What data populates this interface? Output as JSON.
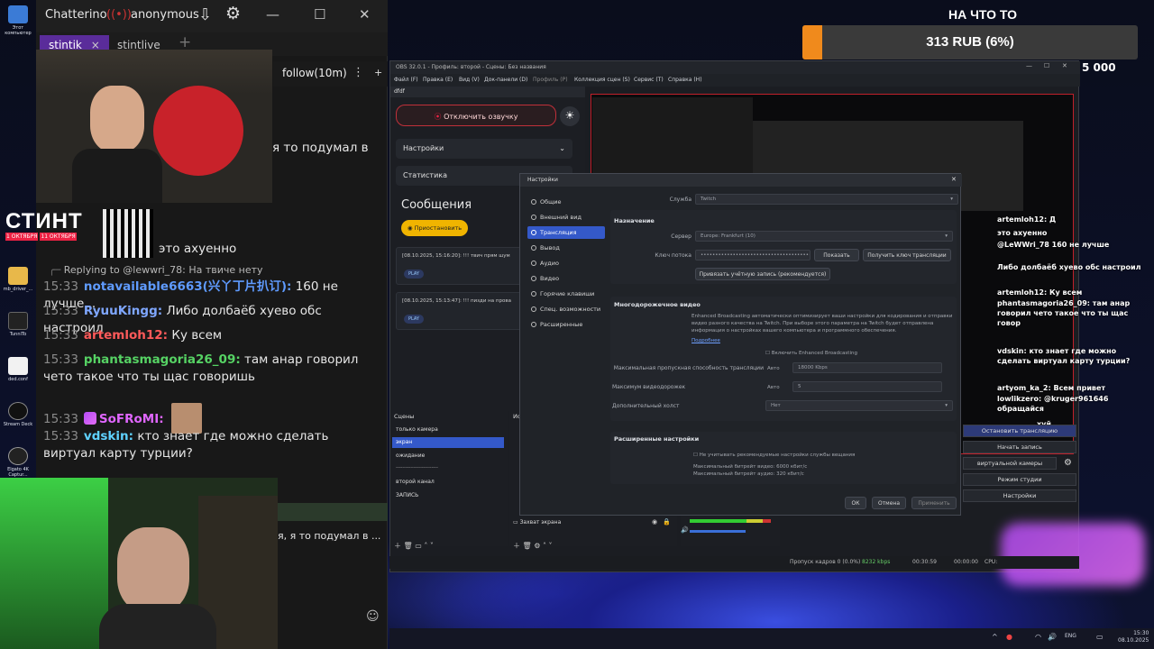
{
  "desktop_icons": [
    {
      "label": "Этот компьютер"
    },
    {
      "label": "mb_driver_..."
    },
    {
      "label": "TunnITo"
    },
    {
      "label": "ded.conf"
    },
    {
      "label": "Stream Deck"
    },
    {
      "label": "Elgato 4K Captur..."
    }
  ],
  "chatterino": {
    "title": "Chatterino",
    "user": "anonymous",
    "tabs": [
      "stintik",
      "stintlive"
    ],
    "channel_status": "follow(10m)",
    "partial_text_1": "я то подумал в",
    "partial_text_2": "это ахуенно",
    "reply": {
      "prefix": "Replying to",
      "target": "@lewwri_78:",
      "text": "На твиче нету"
    },
    "messages": [
      {
        "time": "15:33",
        "user": "notavailable6663(兴丫丁片扒订):",
        "text": "160 не лучше...",
        "color": "#5f9bff"
      },
      {
        "time": "15:33",
        "user": "RyuuKingg:",
        "text": "Либо долбаёб хуево обс настроил",
        "color": "#7fa7ff"
      },
      {
        "time": "15:33",
        "user": "artemloh12:",
        "text": "Ку всем",
        "color": "#ff5a5a"
      },
      {
        "time": "15:33",
        "user": "phantasmagoria26_09:",
        "text": "там анар говорил чето такое что ты щас говоришь",
        "color": "#56d364"
      },
      {
        "time": "15:33",
        "user": "SoFRoMI:",
        "text": "",
        "color": "#e066ff"
      },
      {
        "time": "15:33",
        "user": "vdskin:",
        "text": "кто знает где можно сделать виртуал карту турции?",
        "color": "#5fd2ff"
      }
    ],
    "partial_text_3": "я, я то подумал в ..."
  },
  "logo": {
    "text": "СТИНТ",
    "sub1": "1 ОКТЯБРЯ",
    "sub2": "11 ОКТЯБРЯ"
  },
  "donation": {
    "title": "НА ЧТО ТО",
    "amount": "313 RUB (6%)",
    "progress_pct": 6,
    "goal": "5 000"
  },
  "obs": {
    "title": "OBS 32.0.1 - Профиль: второй - Сцены: Без названия",
    "menu": [
      "Файл (F)",
      "Правка (E)",
      "Вид (V)",
      "Док-панели (D)",
      "Профиль (P)",
      "Коллекция сцен (S)",
      "Сервис (T)",
      "Справка (H)"
    ],
    "dock_title": "dfdf",
    "stop_button": "Отключить озвучку",
    "settings_row": "Настройки",
    "stats_row": "Статистика",
    "messages_title": "Сообщения",
    "pause_button": "Приостановить",
    "log": [
      {
        "text": "[08.10.2025, 15:16:20]: !!! твич прям шум",
        "button": "PLAY"
      },
      {
        "text": "[08.10.2025, 15:13:47]: !!! пизди на прова",
        "button": "PLAY"
      }
    ],
    "scenes_title": "Сцены",
    "scenes": [
      "только камера",
      "экран",
      "ожидание",
      "--------------------------",
      "второй канал",
      "ЗАПИСЬ"
    ],
    "sources_title": "Ис",
    "source_item": "Захват экрана",
    "status": {
      "dropped": "Пропуск кадров 0 (0.0%)",
      "bitrate": "8232 kbps",
      "time1": "00:30:59",
      "time2": "00:00:00",
      "cpu": "CPU:"
    }
  },
  "settings": {
    "title": "Настройки",
    "nav": [
      "Общие",
      "Внешний вид",
      "Трансляция",
      "Вывод",
      "Аудио",
      "Видео",
      "Горячие клавиши",
      "Спец. возможности",
      "Расширенные"
    ],
    "service_label": "Служба",
    "service_value": "Twitch",
    "section_destination": "Назначение",
    "server_label": "Сервер",
    "server_value": "Europe: Frankfurt (10)",
    "key_label": "Ключ потока",
    "key_value": "••••••••••••••••••••••••••••••••••••••••",
    "show_button": "Показать",
    "get_key_button": "Получить ключ трансляции",
    "connect_button": "Привязать учётную запись (рекомендуется)",
    "section_multitrack": "Многодорожечное видео",
    "multitrack_desc": "Enhanced Broadcasting автоматически оптимизирует ваши настройки для кодирования и отправки видео разного качества на Twitch. При выборе этого параметра на Twitch будет отправлена информация о настройках вашего компьютера и программного обеспечения.",
    "more_link": "Подробнее",
    "enable_enhanced": "Включить Enhanced Broadcasting",
    "max_bw_label": "Максимальная пропускная способность трансляции",
    "auto": "Авто",
    "max_bw_value": "18000 Kbps",
    "max_tracks_label": "Максимум видеодорожек",
    "max_tracks_value": "5",
    "extra_canvas_label": "Дополнительный холст",
    "extra_canvas_value": "Нет",
    "section_advanced": "Расширенные настройки",
    "ignore_recommended": "Не учитывать рекомендуемые настройки службы вещания",
    "max_video_bitrate": "Максимальный битрейт видео: 6000 кбит/с",
    "max_audio_bitrate": "Максимальный битрейт аудио: 320 кбит/с",
    "ok": "ОК",
    "cancel": "Отмена",
    "apply": "Применить"
  },
  "overlay_chat": [
    {
      "text": "artemloh12: Д"
    },
    {
      "text": "это ахуенно"
    },
    {
      "text": "@LeWWri_78 160 не лучше"
    },
    {
      "text": "Либо долбаёб хуево обс настроил"
    },
    {
      "text": "artemloh12: Ку всем"
    },
    {
      "text": "phantasmagoria26_09: там анар говорил чето такое что ты щас говор"
    },
    {
      "text": "vdskin: кто знает где можно сделать виртуал карту турции?"
    },
    {
      "text": "artyom_ka_2: Всем привет"
    },
    {
      "text": "lowlikzero: @kruger961646 обращайся"
    },
    {
      "text": "хуй"
    }
  ],
  "obs_controls": [
    "Остановить трансляцию",
    "Начать запись",
    "виртуальной камеры",
    "Режим студии",
    "Настройки"
  ],
  "taskbar": {
    "lang": "ENG",
    "time": "15:30",
    "date": "08.10.2025"
  },
  "colors": {
    "accent": "#3459c9",
    "chatterino_tab": "#5a2c9a",
    "donation": "#f08a1c"
  }
}
